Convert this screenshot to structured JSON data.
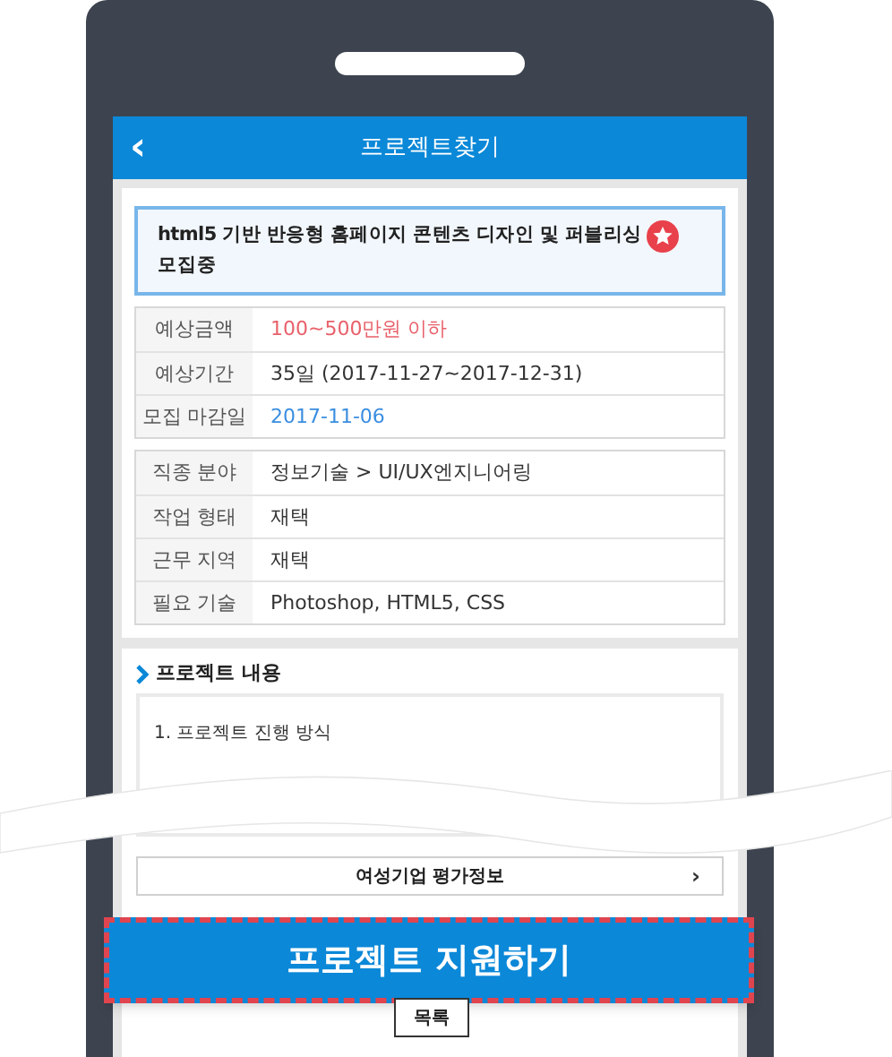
{
  "header": {
    "back": "‹",
    "title": "프로젝트찾기"
  },
  "project": {
    "title": "html5 기반 반응형 홈페이지 콘텐츠 디자인 및 퍼블리싱",
    "featured": true,
    "status": "모집중"
  },
  "summary": [
    {
      "label": "예상금액",
      "value": "100~500만원 이하",
      "kind": "price"
    },
    {
      "label": "예상기간",
      "value": "35일 (2017-11-27~2017-12-31)",
      "kind": "plain"
    },
    {
      "label": "모집 마감일",
      "value": "2017-11-06",
      "kind": "date"
    }
  ],
  "details": [
    {
      "label": "직종 분야",
      "value": "정보기술 > UI/UX엔지니어링"
    },
    {
      "label": "작업 형태",
      "value": "재택"
    },
    {
      "label": "근무 지역",
      "value": "재택"
    },
    {
      "label": "필요 기술",
      "value": "Photoshop, HTML5, CSS"
    }
  ],
  "content": {
    "heading": "프로젝트 내용",
    "body": "1. 프로젝트 진행 방식"
  },
  "evaluation_link": {
    "label": "여성기업 평가정보",
    "chevron": "›"
  },
  "apply_button": "프로젝트 지원하기",
  "list_button": "목록"
}
